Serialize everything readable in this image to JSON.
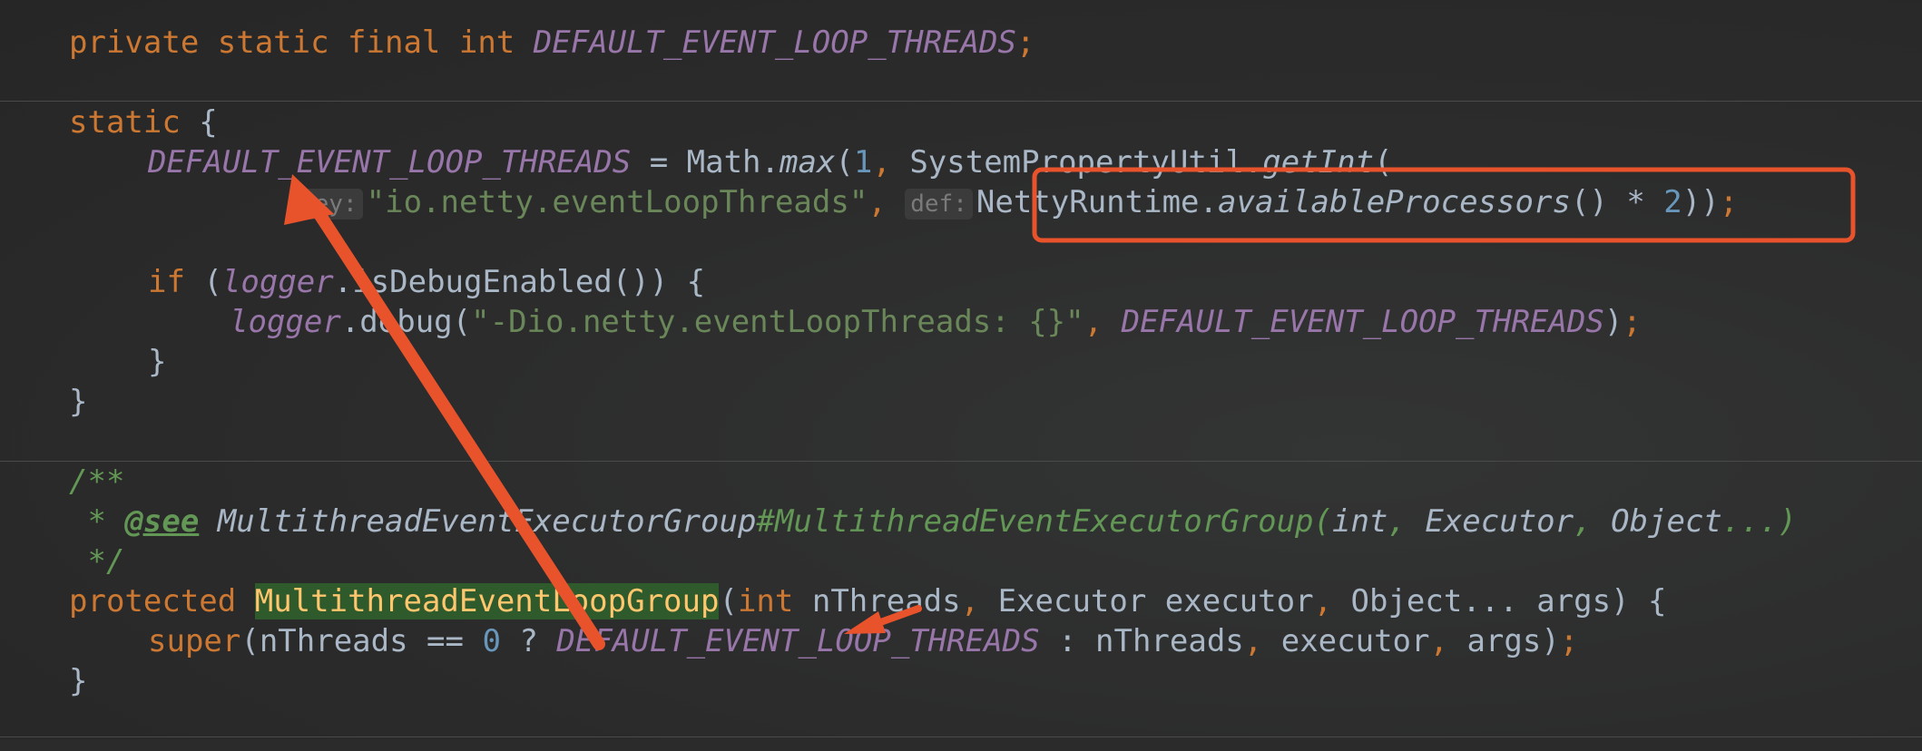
{
  "code": {
    "line1": {
      "mods": "private static final int ",
      "const": "DEFAULT_EVENT_LOOP_THREADS",
      "semi": ";"
    },
    "line2": {
      "kw": "static",
      "brace": " {"
    },
    "line3": {
      "const": "DEFAULT_EVENT_LOOP_THREADS",
      "assign": " = Math.",
      "max": "max",
      "open": "(",
      "one": "1",
      "comma": ", ",
      "util": "SystemPropertyUtil.",
      "getint": "getInt",
      "paren": "("
    },
    "line4": {
      "hint_key": "key:",
      "str": "\"io.netty.eventLoopThreads\"",
      "comma": ", ",
      "hint_def": "def:",
      "runtime": "NettyRuntime.",
      "avail": "availableProcessors",
      "mul": "() * ",
      "two": "2",
      "close": "))",
      "semi": ";"
    },
    "line5": {
      "kw": "if",
      "open": " (",
      "logger": "logger",
      "call": ".isDebugEnabled()) {"
    },
    "line6": {
      "logger": "logger",
      "call": ".debug(",
      "str": "\"-Dio.netty.eventLoopThreads: {}\"",
      "comma": ", ",
      "const": "DEFAULT_EVENT_LOOP_THREADS",
      "close": ")",
      "semi": ";"
    },
    "line7": {
      "brace": "}"
    },
    "line8": {
      "brace": "}"
    },
    "line9": {
      "doc": "/**"
    },
    "line10": {
      "star": " * ",
      "tag": "@see",
      "sp": " ",
      "ref": "MultithreadEventExecutorGroup",
      "member": "#MultithreadEventExecutorGroup(",
      "int": "int",
      "c1": ", ",
      "exec": "Executor",
      "c2": ", ",
      "obj": "Object",
      "rest": "...)"
    },
    "line11": {
      "doc": " */"
    },
    "line12": {
      "kw": "protected",
      "sp": " ",
      "cls": "MultithreadEventLoopGroup",
      "open": "(",
      "int": "int",
      "p1": " nThreads",
      "c1": ", ",
      "p2": "Executor executor",
      "c2": ", ",
      "p3": "Object... args) {"
    },
    "line13": {
      "kw": "super",
      "p1": "(nThreads == ",
      "zero": "0",
      "q": " ? ",
      "const": "DEFAULT_EVENT_LOOP_THREADS",
      "p2": " : nThreads",
      "c1": ", ",
      "p3": "executor",
      "c2": ", ",
      "p4": "args)",
      "semi": ";"
    },
    "line14": {
      "brace": "}"
    }
  },
  "colors": {
    "background": "#2b2b2b",
    "keyword": "#cc7832",
    "constant": "#9876aa",
    "string": "#6a8759",
    "number": "#6897bb",
    "text": "#a9b7c6",
    "doc": "#629755",
    "highlight_class": "#ffc66d",
    "annotation": "#e8532b"
  },
  "annotations": {
    "box_target": "NettyRuntime.availableProcessors() * 2",
    "arrows": "red arrows linking DEFAULT_EVENT_LOOP_THREADS usages"
  }
}
